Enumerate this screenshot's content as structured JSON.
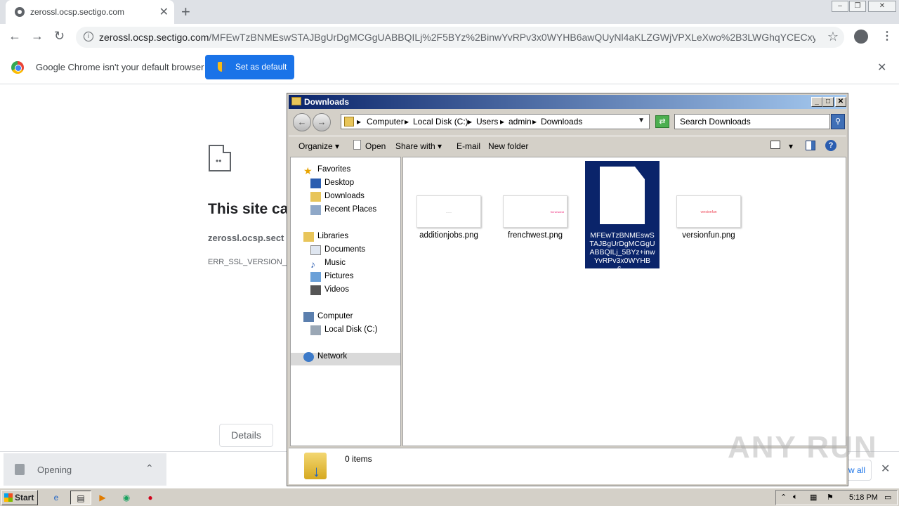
{
  "browser": {
    "tab_title": "zerossl.ocsp.sectigo.com",
    "url_host": "zerossl.ocsp.sectigo.com",
    "url_path": "/MFEwTzBNMEswSTAJBgUrDgMCGgUABBQILj%2F5BYz%2BinwYvRPv3x0WYHB6awQUyNl4aKLZGWjVPXLeXwo%2B3LWGhqYCECxyK0Kdd...",
    "infobar_text": "Google Chrome isn't your default browser",
    "set_default_label": "Set as default"
  },
  "error_page": {
    "title": "This site ca",
    "host": "zerossl.ocsp.sect",
    "code": "ERR_SSL_VERSION_OF",
    "details_label": "Details"
  },
  "downloads_bar": {
    "item_status": "Opening",
    "show_all": "w all"
  },
  "explorer": {
    "title": "Downloads",
    "breadcrumb": [
      "Computer",
      "Local Disk (C:)",
      "Users",
      "admin",
      "Downloads"
    ],
    "search_placeholder": "Search Downloads",
    "commands": {
      "organize": "Organize",
      "open": "Open",
      "share_with": "Share with",
      "email": "E-mail",
      "new_folder": "New folder"
    },
    "nav": {
      "favorites": "Favorites",
      "desktop": "Desktop",
      "downloads": "Downloads",
      "recent": "Recent Places",
      "libraries": "Libraries",
      "documents": "Documents",
      "music": "Music",
      "pictures": "Pictures",
      "videos": "Videos",
      "computer": "Computer",
      "local_disk": "Local Disk (C:)",
      "network": "Network"
    },
    "files": [
      {
        "name": "additionjobs.png",
        "thumb_text": "------"
      },
      {
        "name": "frenchwest.png",
        "thumb_text": "frenchwest"
      },
      {
        "name": "versionfun.png",
        "thumb_text": "versionfun"
      }
    ],
    "selected_file": "MFEwTzBNMEswSTAJBgUrDgMCGgUABBQILj_5BYz+inwYvRPv3x0WYHB6...",
    "status": "0 items"
  },
  "watermark": "ANY RUN",
  "taskbar": {
    "start": "Start",
    "clock": "5:18 PM"
  }
}
